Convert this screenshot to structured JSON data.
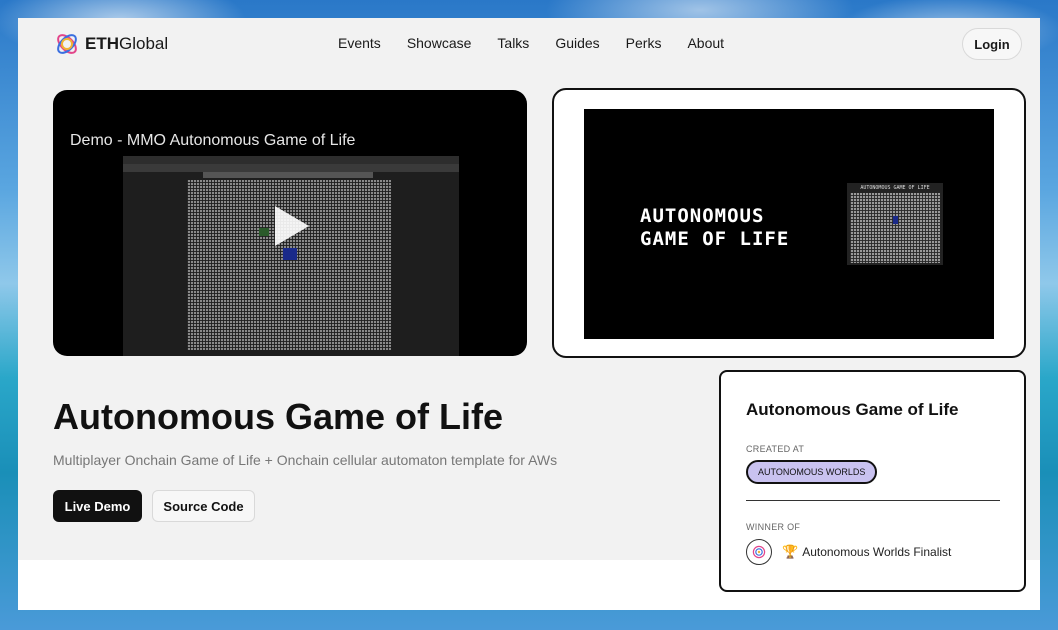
{
  "brand": {
    "logo_bold": "ETH",
    "logo_light": "Global"
  },
  "nav": {
    "links": [
      "Events",
      "Showcase",
      "Talks",
      "Guides",
      "Perks",
      "About"
    ],
    "login_label": "Login"
  },
  "video": {
    "title": "Demo - MMO Autonomous Game of Life"
  },
  "thumbnail": {
    "line1": "AUTONOMOUS",
    "line2": "GAME OF LIFE",
    "mini_head": "AUTONOMOUS GAME OF LIFE"
  },
  "project": {
    "title": "Autonomous Game of Life",
    "description": "Multiplayer Onchain Game of Life + Onchain cellular automaton template for AWs",
    "live_demo_label": "Live Demo",
    "source_code_label": "Source Code"
  },
  "card": {
    "title": "Autonomous Game of Life",
    "created_at_label": "CREATED AT",
    "event_tag": "AUTONOMOUS WORLDS",
    "winner_of_label": "WINNER OF",
    "prize": "Autonomous Worlds Finalist"
  },
  "colors": {
    "tag_bg": "#c9c2f0",
    "primary_btn": "#111111"
  }
}
